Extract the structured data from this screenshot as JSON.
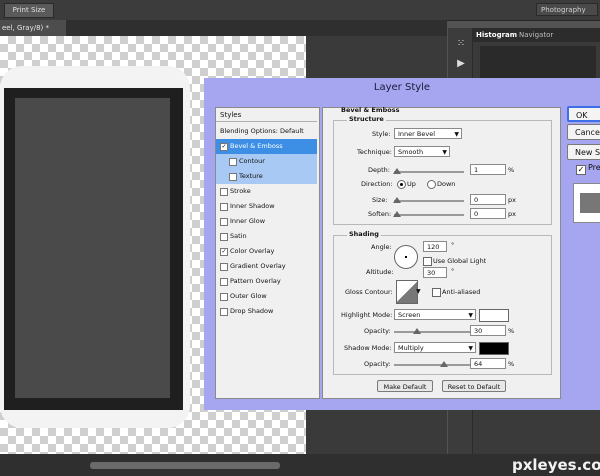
{
  "topbar": {
    "print_size": "Print Size",
    "workspace": "Photography"
  },
  "doc_tab": "eel, Gray/8) *",
  "right_panel": {
    "tabs": [
      "Histogram",
      "Navigator"
    ]
  },
  "dialog": {
    "title": "Layer Style",
    "buttons": {
      "ok": "OK",
      "cancel": "Cancel",
      "new_style": "New Style...",
      "preview": "Preview"
    },
    "styles_header": "Styles",
    "styles_items": [
      {
        "label": "Blending Options: Default",
        "checked": false
      },
      {
        "label": "Bevel & Emboss",
        "checked": true,
        "selected": true
      },
      {
        "label": "Contour",
        "checked": false
      },
      {
        "label": "Texture",
        "checked": false
      },
      {
        "label": "Stroke",
        "checked": false
      },
      {
        "label": "Inner Shadow",
        "checked": false
      },
      {
        "label": "Inner Glow",
        "checked": false
      },
      {
        "label": "Satin",
        "checked": false
      },
      {
        "label": "Color Overlay",
        "checked": true
      },
      {
        "label": "Gradient Overlay",
        "checked": false
      },
      {
        "label": "Pattern Overlay",
        "checked": false
      },
      {
        "label": "Outer Glow",
        "checked": false
      },
      {
        "label": "Drop Shadow",
        "checked": false
      }
    ],
    "bevel": {
      "section_title": "Bevel & Emboss",
      "structure_title": "Structure",
      "style_label": "Style:",
      "style_value": "Inner Bevel",
      "technique_label": "Technique:",
      "technique_value": "Smooth",
      "depth_label": "Depth:",
      "depth_value": "1",
      "depth_unit": "%",
      "direction_label": "Direction:",
      "direction_up": "Up",
      "direction_down": "Down",
      "direction_selected": "Up",
      "size_label": "Size:",
      "size_value": "0",
      "size_unit": "px",
      "soften_label": "Soften:",
      "soften_value": "0",
      "soften_unit": "px",
      "shading_title": "Shading",
      "angle_label": "Angle:",
      "angle_value": "120",
      "angle_unit": "°",
      "global_light_label": "Use Global Light",
      "global_light_checked": false,
      "altitude_label": "Altitude:",
      "altitude_value": "30",
      "altitude_unit": "°",
      "gloss_label": "Gloss Contour:",
      "antialiased_label": "Anti-aliased",
      "antialiased_checked": false,
      "highlight_label": "Highlight Mode:",
      "highlight_value": "Screen",
      "highlight_color": "#ffffff",
      "highlight_opacity_label": "Opacity:",
      "highlight_opacity_value": "30",
      "highlight_opacity_unit": "%",
      "shadow_label": "Shadow Mode:",
      "shadow_value": "Multiply",
      "shadow_color": "#000000",
      "shadow_opacity_label": "Opacity:",
      "shadow_opacity_value": "64",
      "shadow_opacity_unit": "%",
      "make_default": "Make Default",
      "reset_default": "Reset to Default"
    }
  },
  "watermark": "pxleyes.com"
}
